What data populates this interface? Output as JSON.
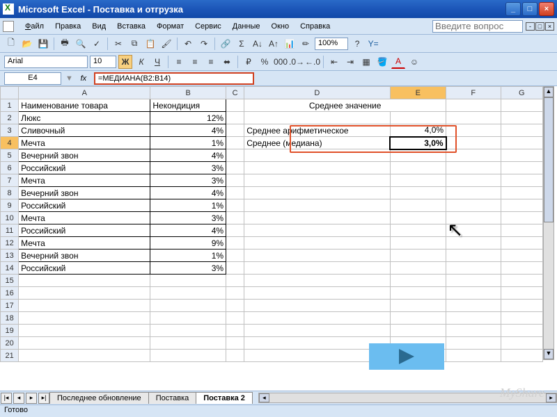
{
  "window": {
    "title": "Microsoft Excel - Поставка и отгрузка"
  },
  "menu": {
    "file": "Файл",
    "edit": "Правка",
    "view": "Вид",
    "insert": "Вставка",
    "format": "Формат",
    "service": "Сервис",
    "data": "Данные",
    "window": "Окно",
    "help": "Справка",
    "ask_placeholder": "Введите вопрос"
  },
  "toolbar": {
    "zoom": "100%",
    "font": "Arial",
    "size": "10"
  },
  "formula": {
    "cellref": "E4",
    "text": "=МЕДИАНА(B2:B14)"
  },
  "columns": [
    "A",
    "B",
    "C",
    "D",
    "E",
    "F",
    "G"
  ],
  "headers": {
    "A1": "Наименование товара",
    "B1": "Некондиция",
    "D1": "Среднее значение"
  },
  "rows": [
    {
      "n": "2",
      "a": "Люкс",
      "b": "12%"
    },
    {
      "n": "3",
      "a": "Сливочный",
      "b": "4%"
    },
    {
      "n": "4",
      "a": "Мечта",
      "b": "1%"
    },
    {
      "n": "5",
      "a": "Вечерний звон",
      "b": "4%"
    },
    {
      "n": "6",
      "a": "Российский",
      "b": "3%"
    },
    {
      "n": "7",
      "a": "Мечта",
      "b": "3%"
    },
    {
      "n": "8",
      "a": "Вечерний звон",
      "b": "4%"
    },
    {
      "n": "9",
      "a": "Российский",
      "b": "1%"
    },
    {
      "n": "10",
      "a": "Мечта",
      "b": "3%"
    },
    {
      "n": "11",
      "a": "Российский",
      "b": "4%"
    },
    {
      "n": "12",
      "a": "Мечта",
      "b": "9%"
    },
    {
      "n": "13",
      "a": "Вечерний звон",
      "b": "1%"
    },
    {
      "n": "14",
      "a": "Российский",
      "b": "3%"
    }
  ],
  "blank_rows": [
    "15",
    "16",
    "17",
    "18",
    "19",
    "20",
    "21"
  ],
  "stats": {
    "arith_label": "Среднее арифметическое",
    "arith_val": "4,0%",
    "median_label": "Среднее (медиана)",
    "median_val": "3,0%"
  },
  "tabs": {
    "t1": "Последнее обновление",
    "t2": "Поставка",
    "t3": "Поставка 2"
  },
  "status": "Готово",
  "watermark": "MyShare",
  "chart_data": {
    "type": "table",
    "title": "Поставка и отгрузка — Некондиция",
    "columns": [
      "Наименование товара",
      "Некондиция %"
    ],
    "rows": [
      [
        "Люкс",
        12
      ],
      [
        "Сливочный",
        4
      ],
      [
        "Мечта",
        1
      ],
      [
        "Вечерний звон",
        4
      ],
      [
        "Российский",
        3
      ],
      [
        "Мечта",
        3
      ],
      [
        "Вечерний звон",
        4
      ],
      [
        "Российский",
        1
      ],
      [
        "Мечта",
        3
      ],
      [
        "Российский",
        4
      ],
      [
        "Мечта",
        9
      ],
      [
        "Вечерний звон",
        1
      ],
      [
        "Российский",
        3
      ]
    ],
    "summary": {
      "Среднее арифметическое": 4.0,
      "Среднее (медиана)": 3.0
    }
  }
}
